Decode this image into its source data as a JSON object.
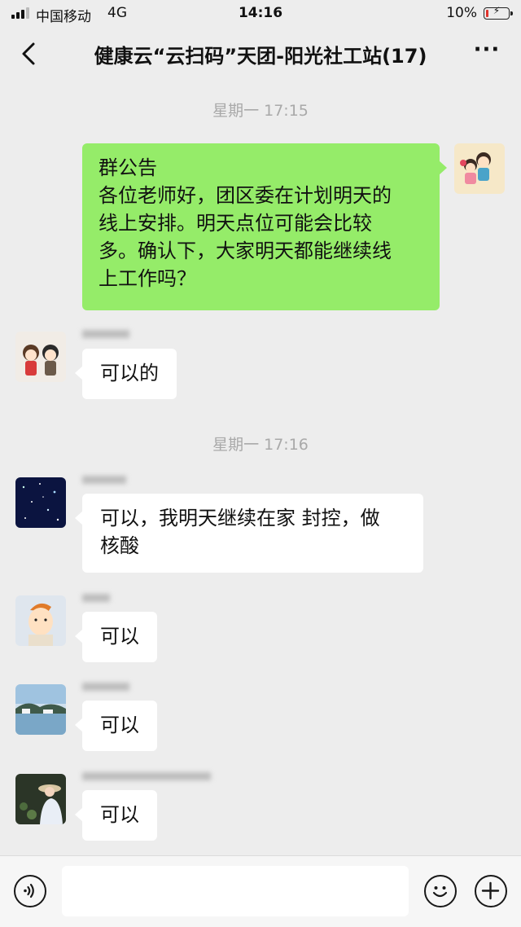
{
  "status_bar": {
    "carrier": "中国移动",
    "network": "4G",
    "time": "14:16",
    "battery_percent": "10%",
    "battery_level": 0.1,
    "signal_bars": 3
  },
  "header": {
    "back_icon": "chevron-left-icon",
    "title": "健康云“云扫码”天团-阳光社工站(17)",
    "more_icon": "more-dots-icon",
    "more_label": "···"
  },
  "timestamps": [
    "星期一 17:15",
    "星期一 17:16"
  ],
  "messages": [
    {
      "direction": "outgoing",
      "avatar": "cartoon-kids-avatar",
      "lines": [
        "群公告",
        "各位老师好，团区委在计划明天的",
        "线上安排。明天点位可能会比较",
        "多。确认下，大家明天都能继续线",
        "上工作吗？"
      ]
    },
    {
      "direction": "incoming",
      "avatar": "cartoon-couple-avatar",
      "lines": [
        "可以的"
      ]
    },
    {
      "direction": "incoming",
      "avatar": "starry-night-avatar",
      "lines": [
        "可以，我明天继续在家 封控，做",
        "核酸"
      ]
    },
    {
      "direction": "incoming",
      "avatar": "cartoon-face-avatar",
      "lines": [
        "可以"
      ]
    },
    {
      "direction": "incoming",
      "avatar": "lake-landscape-avatar",
      "lines": [
        "可以"
      ]
    },
    {
      "direction": "incoming",
      "avatar": "girl-with-hat-avatar",
      "lines": [
        "可以"
      ]
    }
  ],
  "input_bar": {
    "voice_icon": "voice-icon",
    "emoji_icon": "emoji-icon",
    "add_icon": "plus-icon",
    "text_value": ""
  },
  "colors": {
    "chat_background": "#ededed",
    "outgoing_bubble": "#95ec69",
    "incoming_bubble": "#ffffff",
    "timestamp_text": "#a9a9a9",
    "battery_low": "#e0322b"
  }
}
